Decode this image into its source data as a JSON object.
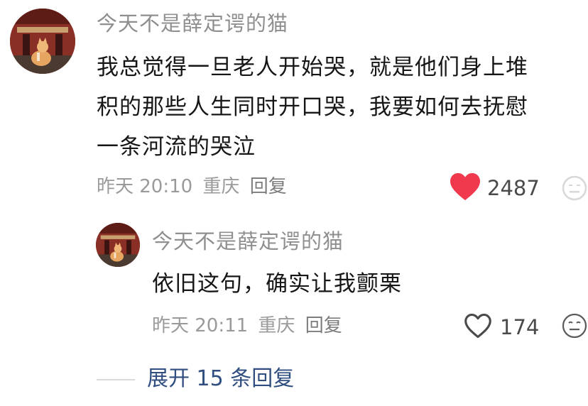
{
  "comment": {
    "avatar_icon": "cat-avatar-icon",
    "username": "今天不是薛定谔的猫",
    "text": "我总觉得一旦老人开始哭，就是他们身上堆积的那些人生同时开口哭，我要如何去抚慰一条河流的哭泣",
    "date": "昨天 20:10",
    "location": "重庆",
    "reply_label": "回复",
    "like_icon": "heart-filled-icon",
    "like_count": "2487",
    "like_color": "#f0394d"
  },
  "reply": {
    "avatar_icon": "cat-avatar-icon",
    "username": "今天不是薛定谔的猫",
    "text": "依旧这句，确实让我颤栗",
    "date": "昨天 20:11",
    "location": "重庆",
    "reply_label": "回复",
    "like_icon": "heart-outline-icon",
    "like_count": "174",
    "emoji_icon": "emoji-reaction-icon"
  },
  "expand": {
    "label": "展开 15 条回复",
    "color": "#304e80"
  }
}
